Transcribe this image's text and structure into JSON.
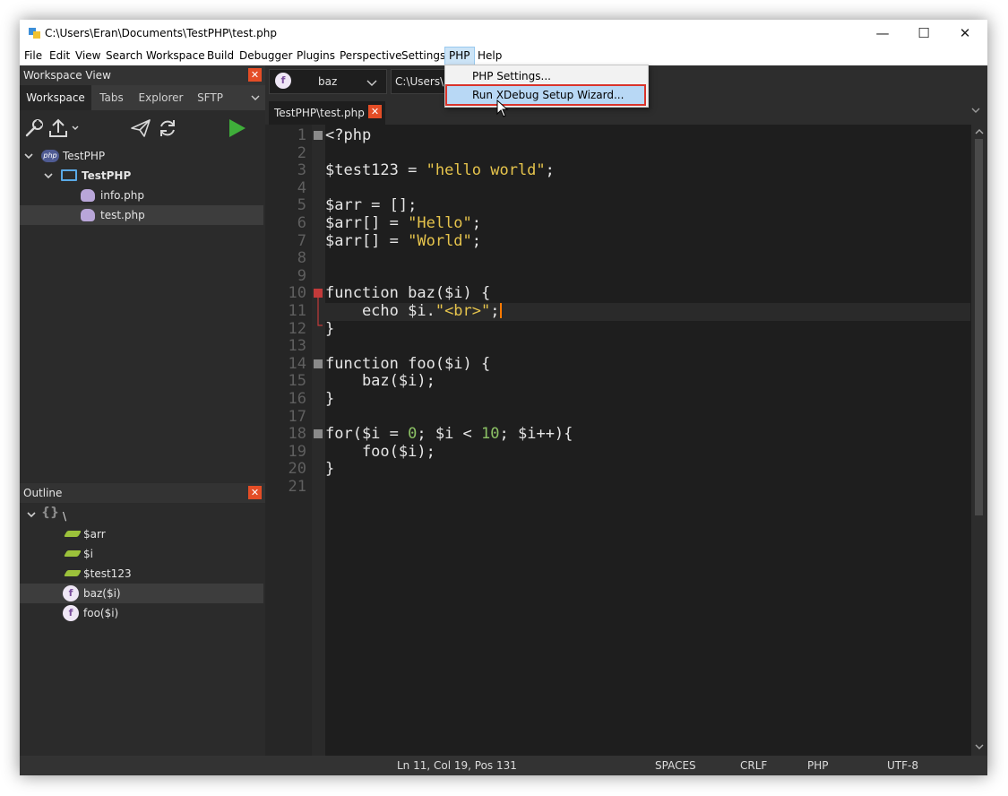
{
  "window": {
    "title": "C:\\Users\\Eran\\Documents\\TestPHP\\test.php",
    "controls": {
      "minimize": "—",
      "maximize": "☐",
      "close": "✕"
    }
  },
  "menubar": [
    "File",
    "Edit",
    "View",
    "Search",
    "Workspace",
    "Build",
    "Debugger",
    "Plugins",
    "Perspective",
    "Settings",
    "PHP",
    "Help"
  ],
  "php_menu": {
    "items": [
      "PHP Settings...",
      "Run XDebug Setup Wizard..."
    ]
  },
  "workspace_view": {
    "title": "Workspace View",
    "close": "✕",
    "tabs": [
      "Workspace",
      "Tabs",
      "Explorer",
      "SFTP"
    ],
    "tree": [
      {
        "label": "TestPHP",
        "badge": "php",
        "icon": "php-project-icon"
      },
      {
        "label": "TestPHP",
        "icon": "folder-icon"
      },
      {
        "label": "info.php",
        "icon": "php-file-icon"
      },
      {
        "label": "test.php",
        "icon": "php-file-icon"
      }
    ]
  },
  "outline": {
    "title": "Outline",
    "close": "✕",
    "root": {
      "braces": "{}",
      "label": "\\"
    },
    "items": [
      {
        "label": "$arr",
        "icon": "variable-icon"
      },
      {
        "label": "$i",
        "icon": "variable-icon"
      },
      {
        "label": "$test123",
        "icon": "variable-icon"
      },
      {
        "label": "baz($i)",
        "icon": "function-icon"
      },
      {
        "label": "foo($i)",
        "icon": "function-icon"
      }
    ],
    "fn_letter": "f"
  },
  "editor": {
    "function_combo": {
      "icon_letter": "f",
      "value": "baz"
    },
    "path_combo": {
      "value": "C:\\Users\\E"
    },
    "file_tab": {
      "label": "TestPHP\\test.php",
      "close": "✕"
    },
    "line_numbers": [
      "1",
      "2",
      "3",
      "4",
      "5",
      "6",
      "7",
      "8",
      "9",
      "10",
      "11",
      "12",
      "13",
      "14",
      "15",
      "16",
      "17",
      "18",
      "19",
      "20",
      "21"
    ],
    "code": {
      "l1": "<?php",
      "l3a": "$test123 = ",
      "l3s": "\"hello world\"",
      "l3e": ";",
      "l5": "$arr = [];",
      "l6a": "$arr[] = ",
      "l6s": "\"Hello\"",
      "l6e": ";",
      "l7a": "$arr[] = ",
      "l7s": "\"World\"",
      "l7e": ";",
      "l10": "function baz($i) {",
      "l11a": "    echo $i.",
      "l11s": "\"<br>\"",
      "l11e": ";",
      "l12": "}",
      "l14": "function foo($i) {",
      "l15": "    baz($i);",
      "l16": "}",
      "l18a": "for($i = ",
      "l18n1": "0",
      "l18b": "; $i < ",
      "l18n2": "10",
      "l18c": "; $i++){",
      "l19": "    foo($i);",
      "l20": "}"
    }
  },
  "statusbar": {
    "position": "Ln 11, Col 19, Pos 131",
    "indent": "SPACES",
    "eol": "CRLF",
    "language": "PHP",
    "encoding": "UTF-8"
  }
}
